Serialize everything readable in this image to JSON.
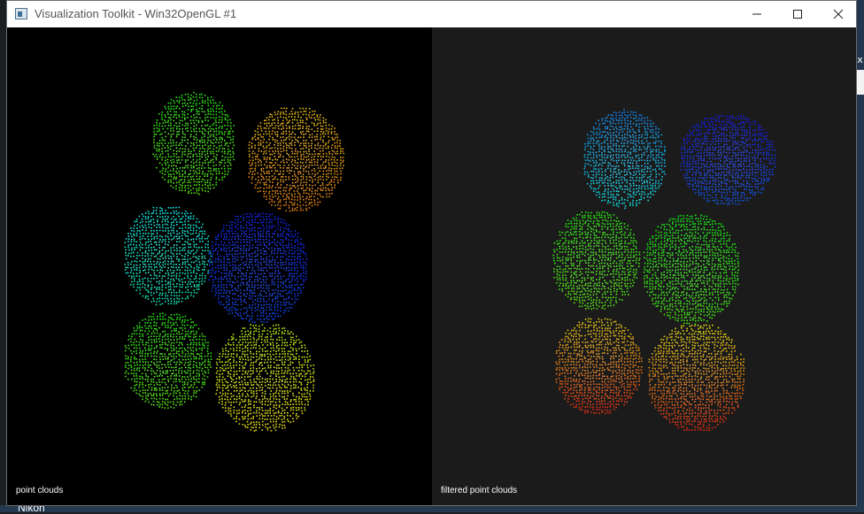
{
  "window": {
    "title": "Visualization Toolkit - Win32OpenGL #1",
    "controls": [
      "minimize",
      "maximize",
      "close"
    ]
  },
  "viewports": {
    "left": {
      "label": "point clouds",
      "background": "#000000"
    },
    "right": {
      "label": "filtered point clouds",
      "background": "#1b1b1b"
    }
  },
  "background_app": {
    "text": "Nikon",
    "close_glyph": "x"
  },
  "icons": {
    "app": "vtk-window-icon",
    "minimize": "minimize-icon",
    "maximize": "maximize-icon",
    "close": "close-icon"
  }
}
